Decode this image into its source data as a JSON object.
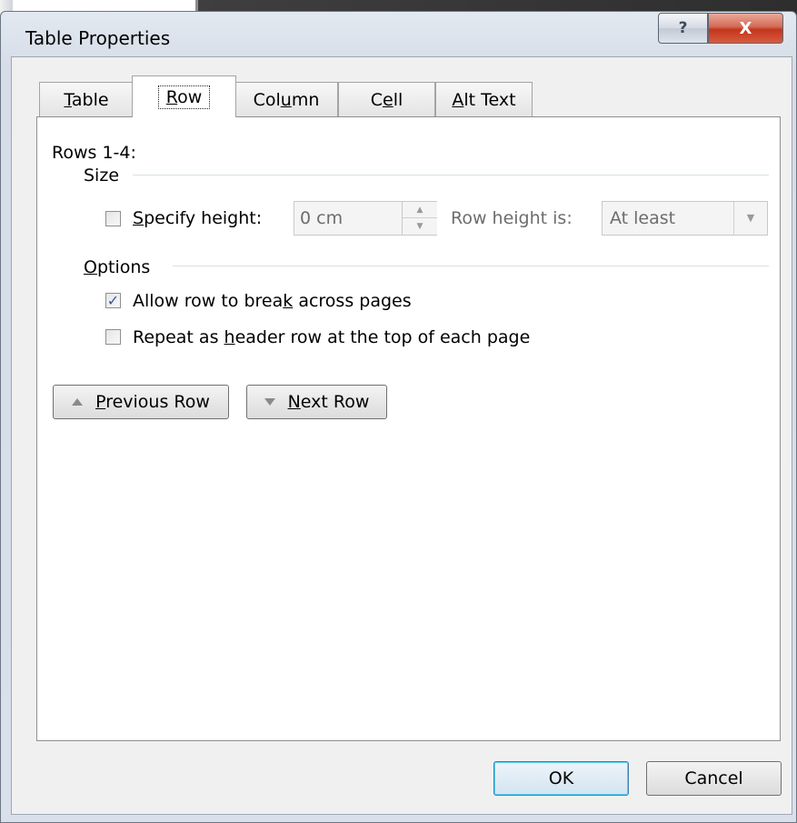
{
  "window": {
    "title": "Table Properties",
    "help_glyph": "?",
    "close_glyph": "X"
  },
  "tabs": [
    {
      "pre": "",
      "u": "T",
      "post": "able"
    },
    {
      "pre": "",
      "u": "R",
      "post": "ow"
    },
    {
      "pre": "Col",
      "u": "u",
      "post": "mn"
    },
    {
      "pre": "C",
      "u": "e",
      "post": "ll"
    },
    {
      "pre": "",
      "u": "A",
      "post": "lt Text"
    }
  ],
  "active_tab": "Row",
  "row_tab": {
    "rows_label": "Rows 1-4:",
    "size_section": "Size",
    "specify_height": {
      "u": "S",
      "rest": "pecify height:",
      "checked": false
    },
    "height_value": "0 cm",
    "row_height_is_label": "Row height is:",
    "row_height_mode": "At least",
    "options_section": {
      "u": "O",
      "rest": "ptions"
    },
    "allow_break": {
      "pre": "Allow row to brea",
      "u": "k",
      "post": " across pages",
      "checked": true
    },
    "repeat_header": {
      "pre": "Repeat as ",
      "u": "h",
      "post": "eader row at the top of each page",
      "checked": false
    },
    "prev_row": {
      "u": "P",
      "rest": "revious Row"
    },
    "next_row": {
      "u": "N",
      "rest": "ext Row"
    }
  },
  "footer": {
    "ok_label": "OK",
    "cancel_label": "Cancel"
  },
  "icons": {
    "check_glyph": "✓",
    "spin_up": "▲",
    "spin_down": "▼",
    "dropdown": "▼"
  }
}
